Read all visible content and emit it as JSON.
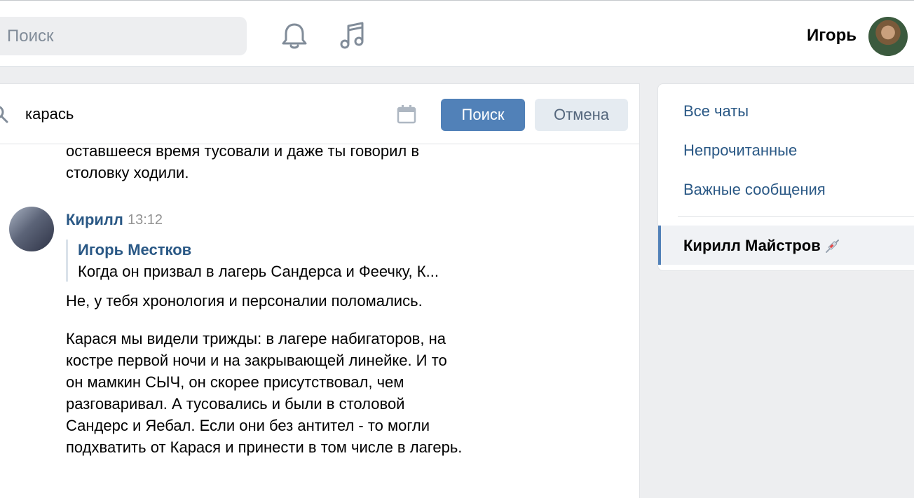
{
  "header": {
    "search_placeholder": "Поиск",
    "user_name": "Игорь",
    "icons": [
      "bell-icon",
      "music-icon"
    ]
  },
  "search": {
    "query": "карась",
    "submit_label": "Поиск",
    "cancel_label": "Отмена"
  },
  "messages": {
    "previous_tail": "оставшееся время тусовали и даже ты говорил в столовку ходили.",
    "current": {
      "author": "Кирилл",
      "time": "13:12",
      "quote": {
        "author": "Игорь Местков",
        "text": "Когда он призвал в лагерь Сандерса и Феечку, К..."
      },
      "paragraph1": "Не, у тебя хронология и персоналии поломались.",
      "paragraph2": "Карася мы видели трижды: в лагере набигаторов, на костре первой ночи и на закрывающей линейке. И то он мамкин СЫЧ, он скорее присутствовал, чем разговаривал. А тусовались и были в столовой Сандерс и Яебал. Если они без антител - то могли подхватить от Карася и принести в том числе в лагерь."
    }
  },
  "sidebar": {
    "items": [
      {
        "label": "Все чаты"
      },
      {
        "label": "Непрочитанные"
      },
      {
        "label": "Важные сообщения"
      }
    ],
    "active_chat": "Кирилл Майстров"
  },
  "colors": {
    "accent": "#5181b8",
    "link": "#2a5885",
    "background": "#edeef0"
  }
}
